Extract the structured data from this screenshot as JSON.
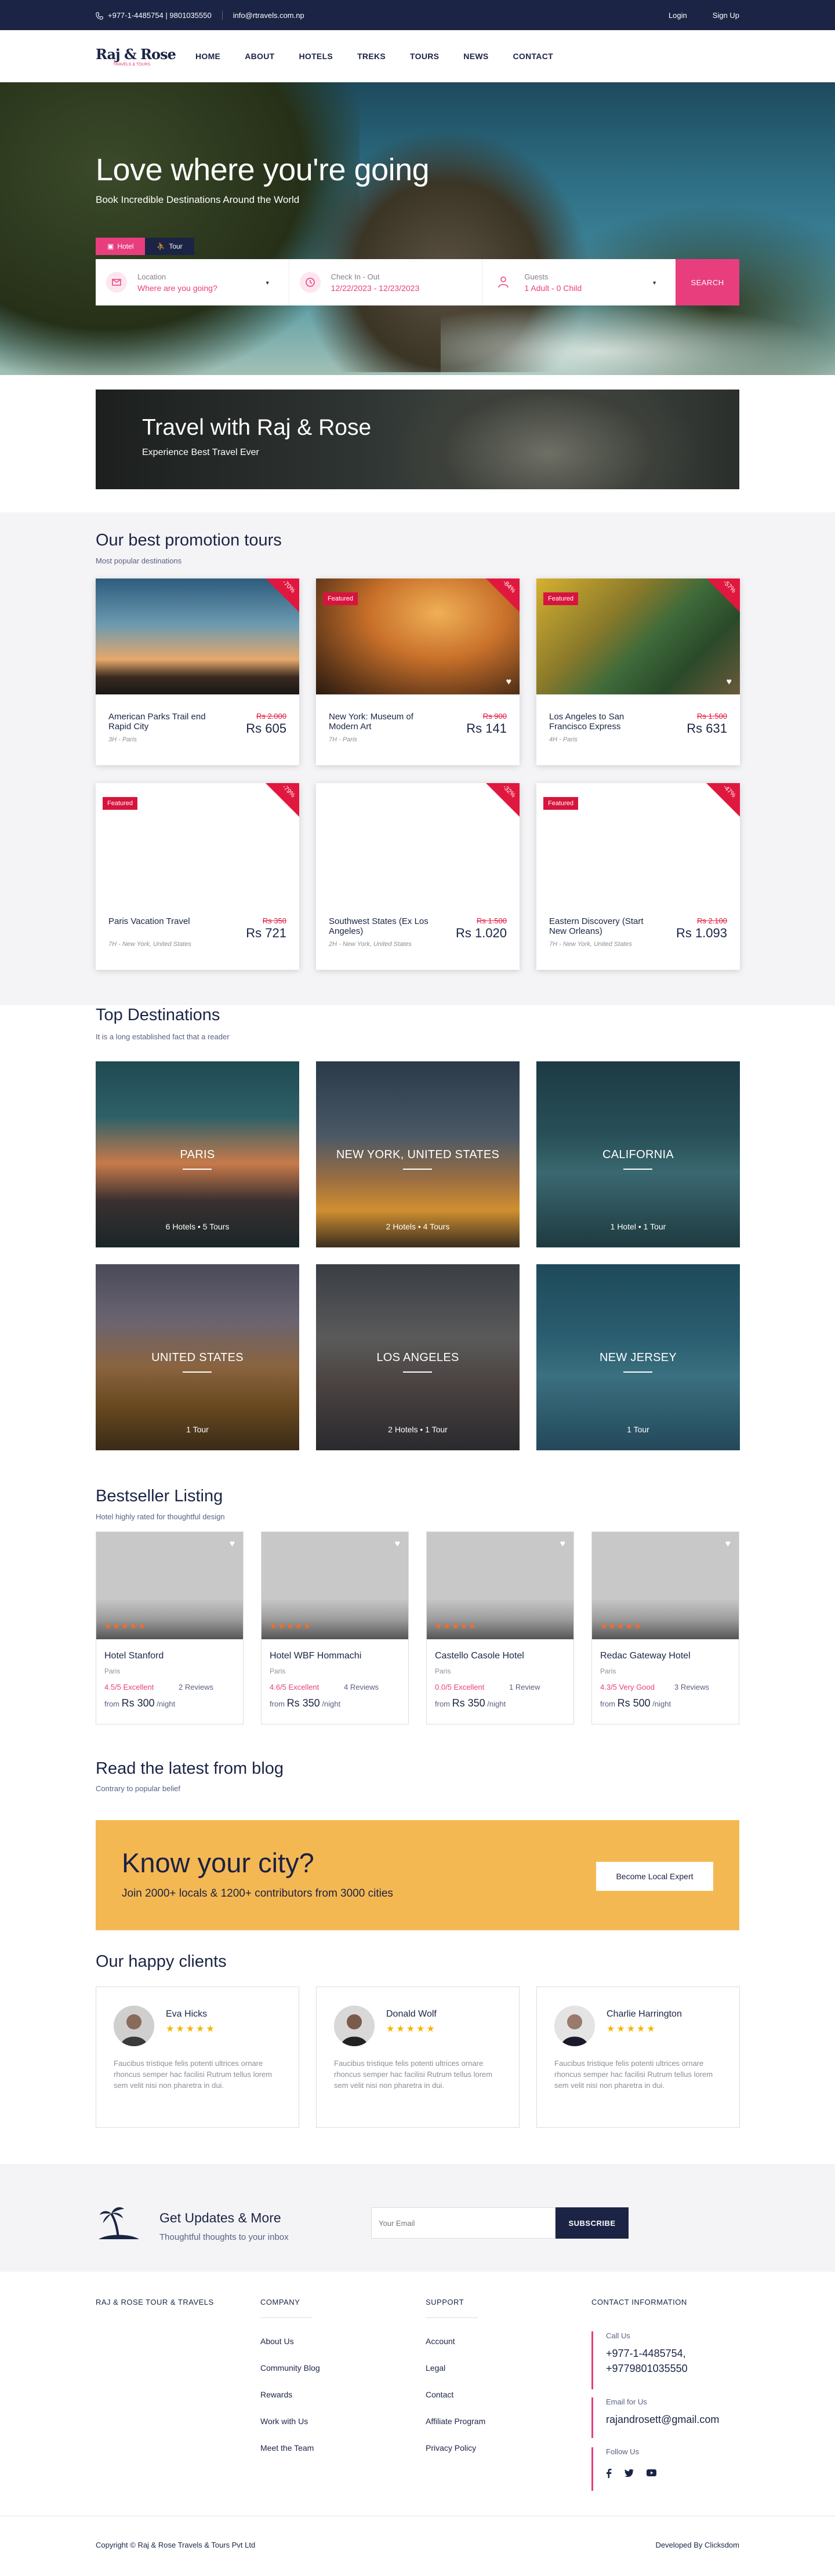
{
  "topbar": {
    "phone": "+977-1-4485754 | 9801035550",
    "email": "info@rtravels.com.np",
    "login": "Login",
    "signup": "Sign Up"
  },
  "nav": {
    "logo": "Raj & Rose",
    "logo_sub": "TRAVELS & TOURS",
    "items": [
      "HOME",
      "ABOUT",
      "HOTELS",
      "TREKS",
      "TOURS",
      "NEWS",
      "CONTACT"
    ]
  },
  "hero": {
    "title": "Love where you're going",
    "subtitle": "Book Incredible Destinations Around the World",
    "tab_hotel": "Hotel",
    "tab_tour": "Tour",
    "location_label": "Location",
    "location_value": "Where are you going?",
    "checkin_label": "Check In - Out",
    "checkin_value": "12/22/2023 - 12/23/2023",
    "guests_label": "Guests",
    "guests_value": "1 Adult - 0 Child",
    "search": "SEARCH"
  },
  "promo": {
    "title": "Travel with Raj & Rose",
    "subtitle": "Experience Best Travel Ever"
  },
  "tours": {
    "title": "Our best promotion tours",
    "subtitle": "Most popular destinations",
    "featured_label": "Featured",
    "items": [
      {
        "name": "American Parks Trail end Rapid City",
        "meta": "3H - Paris",
        "old": "Rs 2.000",
        "price": "Rs 605",
        "pct": "-70%"
      },
      {
        "name": "New York: Museum of Modern Art",
        "meta": "7H - Paris",
        "old": "Rs 900",
        "price": "Rs 141",
        "pct": "-84%"
      },
      {
        "name": "Los Angeles to San Francisco Express",
        "meta": "4H - Paris",
        "old": "Rs 1.500",
        "price": "Rs 631",
        "pct": "-57%"
      },
      {
        "name": "Paris Vacation Travel",
        "meta": "7H - New York, United States",
        "old": "Rs 350",
        "price": "Rs 721",
        "pct": "-79%"
      },
      {
        "name": "Southwest States (Ex Los Angeles)",
        "meta": "2H - New York, United States",
        "old": "Rs 1.500",
        "price": "Rs 1.020",
        "pct": "-32%"
      },
      {
        "name": "Eastern Discovery (Start New Orleans)",
        "meta": "7H - New York, United States",
        "old": "Rs 2.100",
        "price": "Rs 1.093",
        "pct": "-47%"
      }
    ]
  },
  "destinations": {
    "title": "Top Destinations",
    "subtitle": "It is a long established fact that a reader",
    "items": [
      {
        "name": "PARIS",
        "count": "6 Hotels   •   5 Tours"
      },
      {
        "name": "NEW YORK, UNITED STATES",
        "count": "2 Hotels   •   4 Tours"
      },
      {
        "name": "CALIFORNIA",
        "count": "1 Hotel   •   1 Tour"
      },
      {
        "name": "UNITED STATES",
        "count": "1 Tour"
      },
      {
        "name": "LOS ANGELES",
        "count": "2 Hotels   •   1 Tour"
      },
      {
        "name": "NEW JERSEY",
        "count": "1 Tour"
      }
    ]
  },
  "bestseller": {
    "title": "Bestseller Listing",
    "subtitle": "Hotel highly rated for thoughtful design",
    "stars": "★★★★★",
    "from": "from",
    "night": "/night",
    "items": [
      {
        "name": "Hotel Stanford",
        "city": "Paris",
        "rating": "4.5/5 Excellent",
        "reviews": "2 Reviews",
        "price": "Rs 300"
      },
      {
        "name": "Hotel WBF Hommachi",
        "city": "Paris",
        "rating": "4.6/5 Excellent",
        "reviews": "4 Reviews",
        "price": "Rs 350"
      },
      {
        "name": "Castello Casole Hotel",
        "city": "Paris",
        "rating": "0.0/5 Excellent",
        "reviews": "1 Review",
        "price": "Rs 350"
      },
      {
        "name": "Redac Gateway Hotel",
        "city": "Paris",
        "rating": "4.3/5 Very Good",
        "reviews": "3 Reviews",
        "price": "Rs 500"
      }
    ]
  },
  "blog": {
    "title": "Read the latest from blog",
    "subtitle": "Contrary to popular belief"
  },
  "city": {
    "title": "Know your city?",
    "subtitle": "Join 2000+ locals & 1200+ contributors from 3000 cities",
    "button": "Become Local Expert"
  },
  "clients": {
    "title": "Our happy clients",
    "stars": "★★★★★",
    "text": "Faucibus tristique felis potenti ultrices ornare rhoncus semper hac facilisi Rutrum tellus lorem sem velit nisi non pharetra in dui.",
    "items": [
      {
        "name": "Eva Hicks"
      },
      {
        "name": "Donald Wolf"
      },
      {
        "name": "Charlie Harrington"
      }
    ]
  },
  "newsletter": {
    "title": "Get Updates & More",
    "subtitle": "Thoughtful thoughts to your inbox",
    "placeholder": "Your Email",
    "button": "SUBSCRIBE"
  },
  "footer": {
    "brand": "RAJ & ROSE TOUR & TRAVELS",
    "company_title": "COMPANY",
    "company_links": [
      "About Us",
      "Community Blog",
      "Rewards",
      "Work with Us",
      "Meet the Team"
    ],
    "support_title": "SUPPORT",
    "support_links": [
      "Account",
      "Legal",
      "Contact",
      "Affiliate Program",
      "Privacy Policy"
    ],
    "contact_title": "CONTACT INFORMATION",
    "call_label": "Call Us",
    "phone1": "+977-1-4485754,",
    "phone2": "+9779801035550",
    "email_label": "Email for Us",
    "email": "rajandrosett@gmail.com",
    "follow_label": "Follow Us",
    "copyright": "Copyright © Raj & Rose Travels & Tours Pvt Ltd",
    "developed": "Developed By Clicksdom"
  },
  "colors": {
    "navy": "#1b2444",
    "pink": "#e83e7e",
    "red": "#e0183f",
    "yellow": "#f4b853",
    "star": "#f5b400"
  }
}
